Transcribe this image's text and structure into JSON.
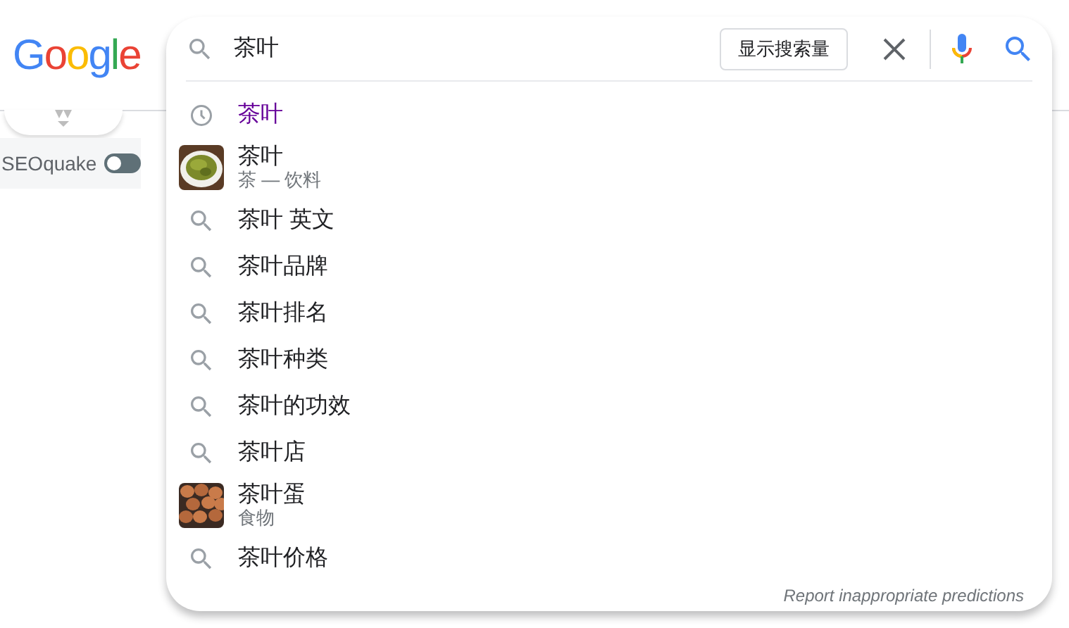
{
  "logo": "Google",
  "search": {
    "value": "茶叶",
    "volume_button": "显示搜索量"
  },
  "suggestions": [
    {
      "kind": "history",
      "text": "茶叶"
    },
    {
      "kind": "entity",
      "text": "茶叶",
      "subtitle": "茶 — 饮料"
    },
    {
      "kind": "query",
      "text": "茶叶 英文"
    },
    {
      "kind": "query",
      "text": "茶叶品牌"
    },
    {
      "kind": "query",
      "text": "茶叶排名"
    },
    {
      "kind": "query",
      "text": "茶叶种类"
    },
    {
      "kind": "query",
      "text": "茶叶的功效"
    },
    {
      "kind": "query",
      "text": "茶叶店"
    },
    {
      "kind": "entity",
      "text": "茶叶蛋",
      "subtitle": "食物"
    },
    {
      "kind": "query",
      "text": "茶叶价格"
    }
  ],
  "report_link": "Report inappropriate predictions",
  "seoquake": {
    "label": "SEOquake",
    "on": false
  }
}
